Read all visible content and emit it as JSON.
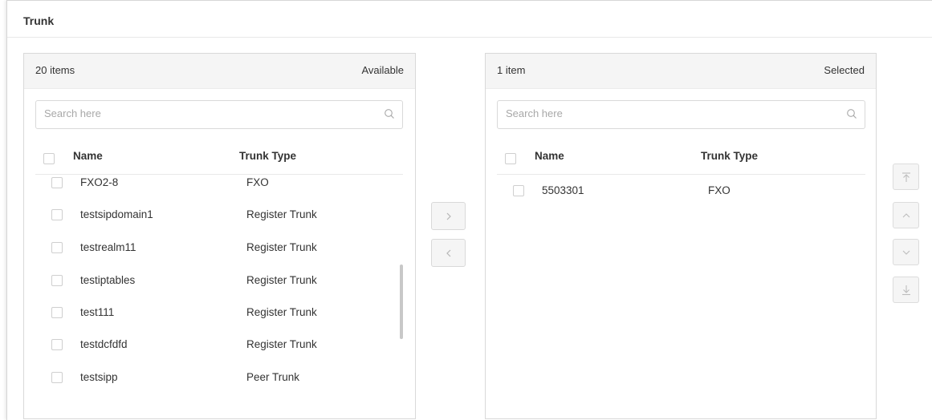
{
  "section": {
    "title": "Trunk"
  },
  "available": {
    "count_label": "20 items",
    "title": "Available",
    "search_placeholder": "Search here",
    "columns": {
      "name": "Name",
      "type": "Trunk Type"
    },
    "rows": [
      {
        "name": "FXO2-8",
        "type": "FXO"
      },
      {
        "name": "testsipdomain1",
        "type": "Register Trunk"
      },
      {
        "name": "testrealm11",
        "type": "Register Trunk"
      },
      {
        "name": "testiptables",
        "type": "Register Trunk"
      },
      {
        "name": "test111",
        "type": "Register Trunk"
      },
      {
        "name": "testdcfdfd",
        "type": "Register Trunk"
      },
      {
        "name": "testsipp",
        "type": "Peer Trunk"
      }
    ]
  },
  "selected": {
    "count_label": "1 item",
    "title": "Selected",
    "search_placeholder": "Search here",
    "columns": {
      "name": "Name",
      "type": "Trunk Type"
    },
    "rows": [
      {
        "name": "5503301",
        "type": "FXO"
      }
    ]
  },
  "icons": {
    "move_right": "chevron-right-icon",
    "move_left": "chevron-left-icon",
    "move_top": "move-to-top-icon",
    "move_up": "chevron-up-icon",
    "move_down": "chevron-down-icon",
    "move_bottom": "move-to-bottom-icon",
    "search": "search-icon"
  },
  "colors": {
    "panel_header": "#f5f5f5",
    "border": "#d9d9d9",
    "text": "#333333",
    "muted": "#a8a8a8"
  }
}
